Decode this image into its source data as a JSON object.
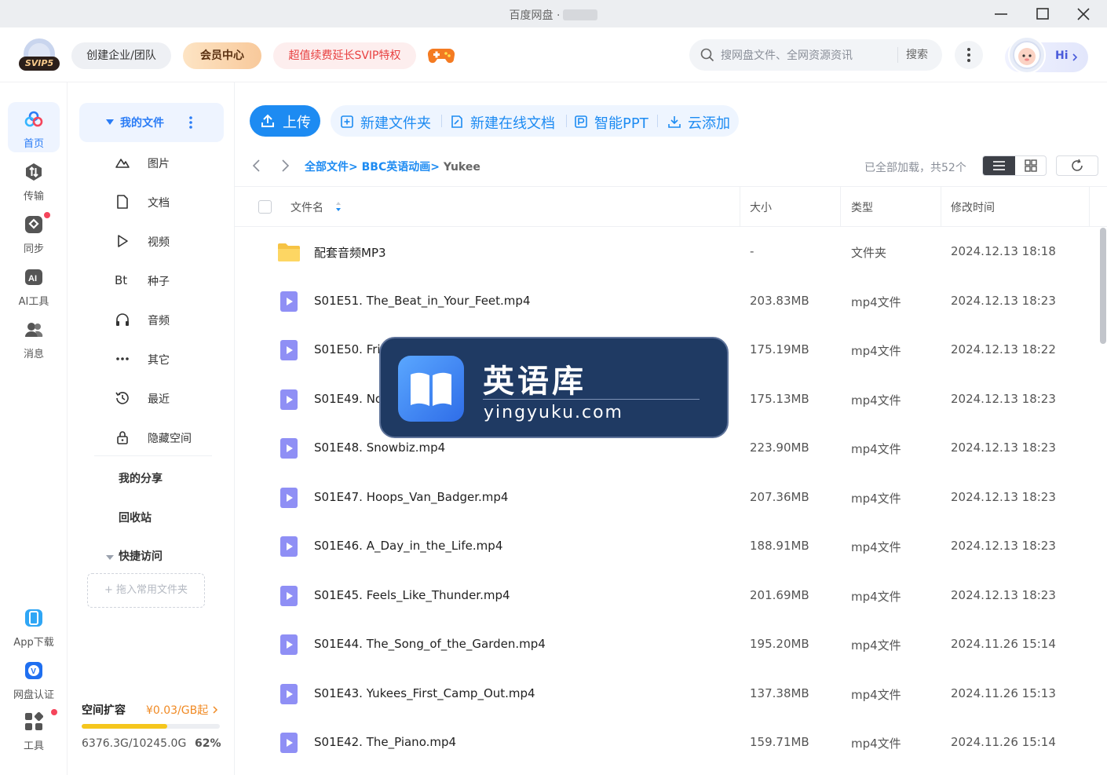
{
  "window": {
    "title": "百度网盘 ·",
    "controls": [
      "minimize",
      "maximize",
      "close"
    ]
  },
  "topbar": {
    "logo_badge": "SVIP5",
    "team_button": "创建企业/团队",
    "vip_button": "会员中心",
    "renew_button": "超值续费延长SVIP特权",
    "search_placeholder": "搜网盘文件、全网资源资讯",
    "search_button": "搜索",
    "greeting": "Hi",
    "colors": {
      "accent": "#1d8bf2",
      "renew": "#e84040",
      "vip_bg": "#f8c99b"
    }
  },
  "rail": {
    "items": [
      {
        "label": "首页",
        "icon": "home-cloud-icon",
        "active": true
      },
      {
        "label": "传输",
        "icon": "transfer-icon"
      },
      {
        "label": "同步",
        "icon": "sync-icon",
        "badge_dot": true
      },
      {
        "label": "AI工具",
        "icon": "ai-tools-icon"
      },
      {
        "label": "消息",
        "icon": "messages-icon"
      }
    ],
    "bottom_items": [
      {
        "label": "App下载",
        "icon": "app-download-icon"
      },
      {
        "label": "网盘认证",
        "icon": "verify-icon"
      },
      {
        "label": "工具",
        "icon": "tools-grid-icon",
        "badge_dot": true
      }
    ]
  },
  "sidebar": {
    "my_files": "我的文件",
    "items": [
      {
        "label": "图片",
        "icon": "image-icon"
      },
      {
        "label": "文档",
        "icon": "document-icon"
      },
      {
        "label": "视频",
        "icon": "video-icon"
      },
      {
        "label": "种子",
        "icon": "torrent-icon",
        "glyph": "Bt"
      },
      {
        "label": "音频",
        "icon": "headphones-icon"
      },
      {
        "label": "其它",
        "icon": "more-dots-icon"
      },
      {
        "label": "最近",
        "icon": "history-icon"
      },
      {
        "label": "隐藏空间",
        "icon": "lock-icon"
      }
    ],
    "my_share": "我的分享",
    "recycle": "回收站",
    "quick_access": "快捷访问",
    "drop_hint": "+ 拖入常用文件夹",
    "storage": {
      "title": "空间扩容",
      "price": "¥0.03/GB起",
      "used": "6376.3G/10245.0G",
      "percent_label": "62%",
      "fill_fraction": 0.62
    }
  },
  "toolbar": {
    "upload": "上传",
    "new_folder": "新建文件夹",
    "new_doc": "新建在线文档",
    "smart_ppt": "智能PPT",
    "cloud_add": "云添加"
  },
  "breadcrumb": {
    "root": "全部文件",
    "folder": "BBC英语动画",
    "current": "Yukee",
    "status": "已全部加载，共52个"
  },
  "table": {
    "columns": {
      "name": "文件名",
      "size": "大小",
      "type": "类型",
      "modified": "修改时间"
    },
    "rows": [
      {
        "name": "配套音频MP3",
        "size": "-",
        "type": "文件夹",
        "modified": "2024.12.13 18:18",
        "kind": "folder"
      },
      {
        "name": "S01E51. The_Beat_in_Your_Feet.mp4",
        "size": "203.83MB",
        "type": "mp4文件",
        "modified": "2024.12.13 18:23",
        "kind": "video"
      },
      {
        "name": "S01E50. Fri",
        "size": "175.19MB",
        "type": "mp4文件",
        "modified": "2024.12.13 18:22",
        "kind": "video"
      },
      {
        "name": "S01E49. No",
        "size": "175.13MB",
        "type": "mp4文件",
        "modified": "2024.12.13 18:23",
        "kind": "video"
      },
      {
        "name": "S01E48. Snowbiz.mp4",
        "size": "223.90MB",
        "type": "mp4文件",
        "modified": "2024.12.13 18:23",
        "kind": "video"
      },
      {
        "name": "S01E47. Hoops_Van_Badger.mp4",
        "size": "207.36MB",
        "type": "mp4文件",
        "modified": "2024.12.13 18:23",
        "kind": "video"
      },
      {
        "name": "S01E46. A_Day_in_the_Life.mp4",
        "size": "188.91MB",
        "type": "mp4文件",
        "modified": "2024.12.13 18:23",
        "kind": "video"
      },
      {
        "name": "S01E45. Feels_Like_Thunder.mp4",
        "size": "201.69MB",
        "type": "mp4文件",
        "modified": "2024.12.13 18:23",
        "kind": "video"
      },
      {
        "name": "S01E44. The_Song_of_the_Garden.mp4",
        "size": "195.20MB",
        "type": "mp4文件",
        "modified": "2024.11.26 15:14",
        "kind": "video"
      },
      {
        "name": "S01E43. Yukees_First_Camp_Out.mp4",
        "size": "137.38MB",
        "type": "mp4文件",
        "modified": "2024.11.26 15:13",
        "kind": "video"
      },
      {
        "name": "S01E42. The_Piano.mp4",
        "size": "159.71MB",
        "type": "mp4文件",
        "modified": "2024.11.26 15:14",
        "kind": "video"
      }
    ]
  },
  "watermark": {
    "title": "英语库",
    "url": "yingyuku.com"
  }
}
